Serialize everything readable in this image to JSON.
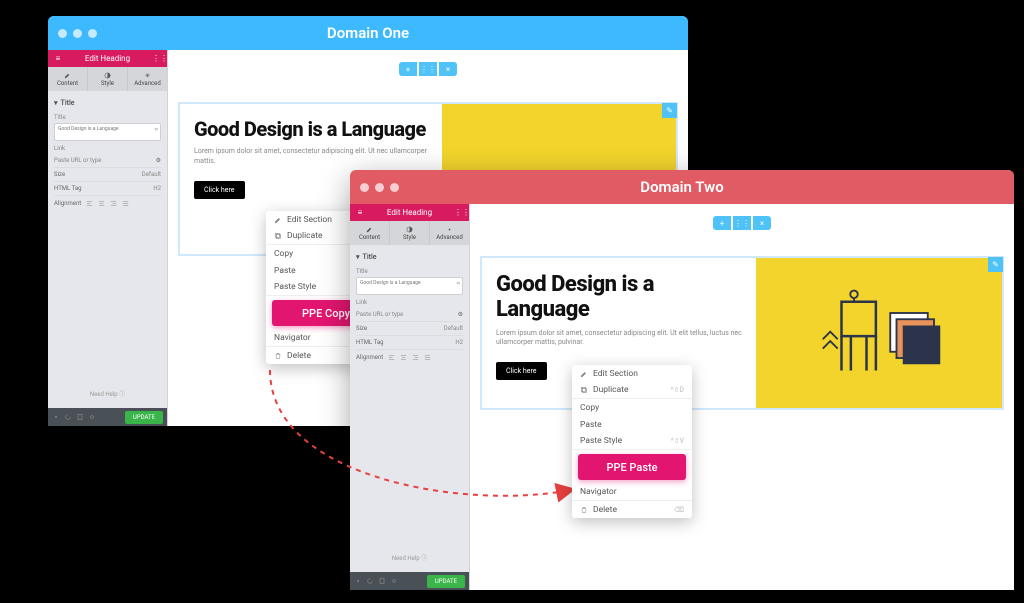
{
  "window1": {
    "title": "Domain One"
  },
  "window2": {
    "title": "Domain Two"
  },
  "sidebar": {
    "heading": "Edit Heading",
    "tabs": [
      "Content",
      "Style",
      "Advanced"
    ],
    "section": "Title",
    "title_label": "Title",
    "title_value": "Good Design is a Language",
    "link_label": "Link",
    "link_placeholder": "Paste URL or type",
    "size_label": "Size",
    "size_value": "Default",
    "tag_label": "HTML Tag",
    "tag_value": "H2",
    "align_label": "Alignment",
    "needhelp": "Need Help",
    "update": "UPDATE"
  },
  "canvas": {
    "big_title": "Good Design is a Language",
    "big_title_short1": "Good Design is a Language",
    "lorem1": "Lorem ipsum dolor sit amet, consectetur adipiscing elit. Ut nec ullamcorper mattis.",
    "lorem2": "Lorem ipsum dolor sit amet, consectetur adipiscing elit. Ut elit tellus, luctus nec ullamcorper mattis, pulvinar.",
    "click": "Click here"
  },
  "ctx": {
    "edit": "Edit Section",
    "dup": "Duplicate",
    "copy": "Copy",
    "paste": "Paste",
    "pastestyle": "Paste Style",
    "ppe_copy": "PPE Copy",
    "ppe_paste": "PPE Paste",
    "nav": "Navigator",
    "del": "Delete",
    "sc_dup": "^⇧D",
    "sc_ps": "^⇧V"
  }
}
